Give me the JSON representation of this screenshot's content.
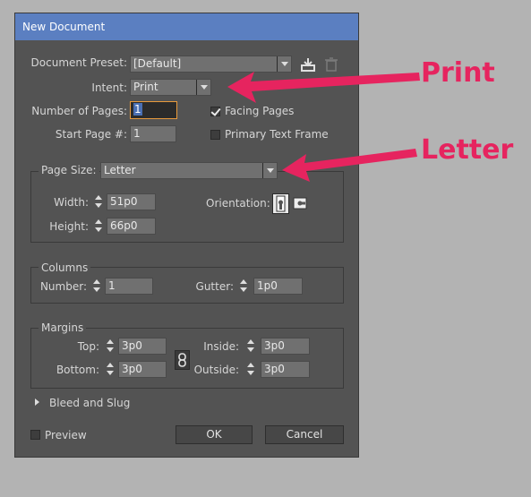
{
  "window": {
    "title": "New Document"
  },
  "preset": {
    "label": "Document Preset:",
    "value": "[Default]"
  },
  "intent": {
    "label": "Intent:",
    "value": "Print"
  },
  "pages": {
    "label": "Number of Pages:",
    "value": "1"
  },
  "start_page": {
    "label": "Start Page #:",
    "value": "1"
  },
  "facing_pages": {
    "label": "Facing Pages",
    "checked": true
  },
  "primary_text_frame": {
    "label": "Primary Text Frame",
    "checked": false
  },
  "page_size": {
    "label": "Page Size:",
    "value": "Letter",
    "width_label": "Width:",
    "width_value": "51p0",
    "height_label": "Height:",
    "height_value": "66p0",
    "orientation_label": "Orientation:"
  },
  "columns": {
    "title": "Columns",
    "number_label": "Number:",
    "number_value": "1",
    "gutter_label": "Gutter:",
    "gutter_value": "1p0"
  },
  "margins": {
    "title": "Margins",
    "top_label": "Top:",
    "top_value": "3p0",
    "bottom_label": "Bottom:",
    "bottom_value": "3p0",
    "inside_label": "Inside:",
    "inside_value": "3p0",
    "outside_label": "Outside:",
    "outside_value": "3p0"
  },
  "bleed": {
    "label": "Bleed and Slug"
  },
  "preview": {
    "label": "Preview",
    "checked": false
  },
  "buttons": {
    "ok": "OK",
    "cancel": "Cancel"
  },
  "annotations": {
    "print": "Print",
    "letter": "Letter",
    "color": "#e6245f"
  }
}
